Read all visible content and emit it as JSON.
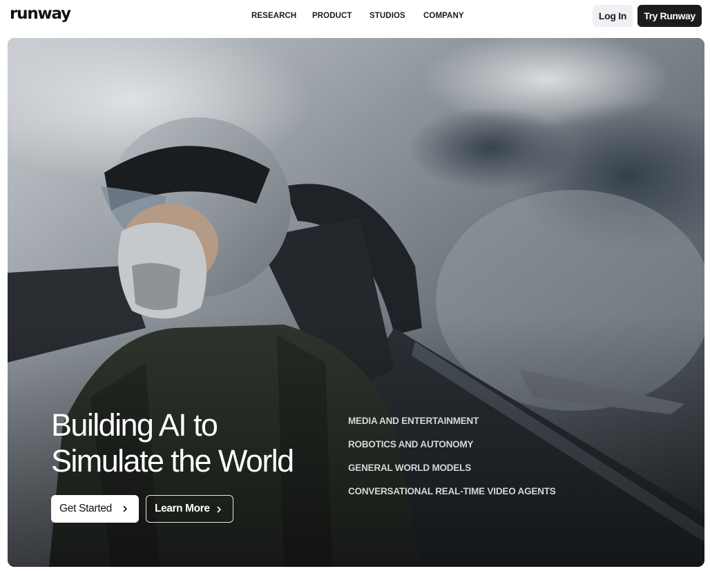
{
  "header": {
    "logo": "runway",
    "nav": [
      "RESEARCH",
      "PRODUCT",
      "STUDIOS",
      "COMPANY"
    ],
    "login_label": "Log In",
    "try_label": "Try Runway"
  },
  "hero": {
    "headline_line1": "Building AI to",
    "headline_line2": "Simulate the World",
    "get_started_label": "Get Started",
    "learn_more_label": "Learn More",
    "use_cases": [
      "MEDIA AND ENTERTAINMENT",
      "ROBOTICS AND AUTONOMY",
      "GENERAL WORLD MODELS",
      "CONVERSATIONAL REAL-TIME VIDEO AGENTS"
    ]
  },
  "colors": {
    "primary_button": "#1c1c1c",
    "login_button_bg": "#eef0f3",
    "hero_text": "#ffffff",
    "use_case_text": "#d4d6d8"
  },
  "icons": [
    "chevron-right-icon"
  ]
}
